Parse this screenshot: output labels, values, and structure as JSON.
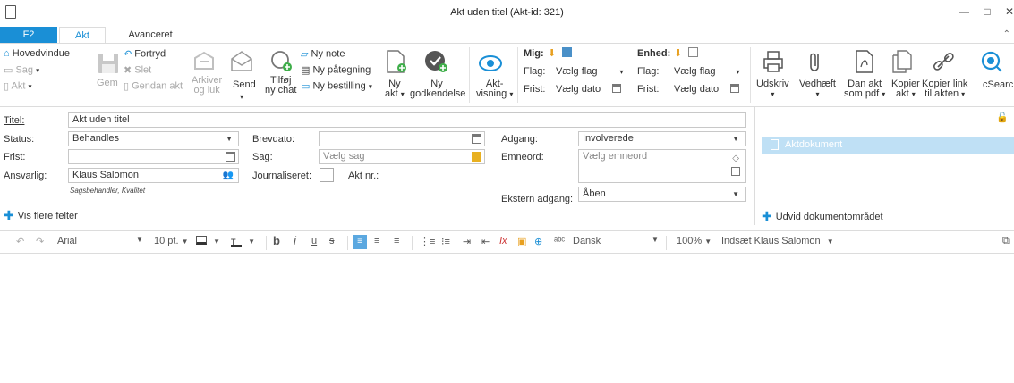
{
  "window": {
    "title": "Akt uden titel (Akt-id: 321)",
    "min": "—",
    "max": "□",
    "close": "✕"
  },
  "tabs": {
    "f2": "F2",
    "akt": "Akt",
    "avanceret": "Avanceret"
  },
  "ribbon": {
    "hovedvindue": "Hovedvindue",
    "sag": "Sag",
    "akt": "Akt",
    "gem": "Gem",
    "fortryd": "Fortryd",
    "slet": "Slet",
    "gendan_akt": "Gendan akt",
    "arkiver_line1": "Arkiver",
    "arkiver_line2": "og luk",
    "send": "Send",
    "tilfoej_line1": "Tilføj",
    "tilfoej_line2": "ny chat",
    "ny_note": "Ny note",
    "ny_paategning": "Ny påtegning",
    "ny_bestilling": "Ny bestilling",
    "ny_akt_line1": "Ny",
    "ny_akt_line2": "akt",
    "ny_godk_line1": "Ny",
    "ny_godk_line2": "godkendelse",
    "aktvisning_line1": "Akt-",
    "aktvisning_line2": "visning",
    "mig_label": "Mig:",
    "enhed_label": "Enhed:",
    "flag_label": "Flag:",
    "frist_label": "Frist:",
    "vaelg_flag": "Vælg flag",
    "vaelg_dato": "Vælg dato",
    "udskriv": "Udskriv",
    "vedhaeft": "Vedhæft",
    "dan_akt_line1": "Dan akt",
    "dan_akt_line2": "som pdf",
    "kopier_akt_line1": "Kopier",
    "kopier_akt_line2": "akt",
    "kopier_link_line1": "Kopier link",
    "kopier_link_line2": "til akten",
    "csearch": "cSearch"
  },
  "form": {
    "titel_label": "Titel:",
    "titel_value": "Akt uden titel",
    "status_label": "Status:",
    "status_value": "Behandles",
    "frist_label": "Frist:",
    "ansvarlig_label": "Ansvarlig:",
    "ansvarlig_value": "Klaus Salomon",
    "ansvarlig_note": "Sagsbehandler, Kvalitet",
    "brevdato_label": "Brevdato:",
    "sag_label": "Sag:",
    "sag_placeholder": "Vælg sag",
    "journaliseret_label": "Journaliseret:",
    "akt_nr_label": "Akt nr.:",
    "adgang_label": "Adgang:",
    "adgang_value": "Involverede",
    "emneord_label": "Emneord:",
    "emneord_placeholder": "Vælg emneord",
    "ekstern_label": "Ekstern adgang:",
    "ekstern_value": "Åben",
    "vis_flere": "Vis flere felter"
  },
  "panel": {
    "aktdokument": "Aktdokument",
    "udvid": "Udvid dokumentområdet"
  },
  "editor": {
    "font": "Arial",
    "size": "10 pt.",
    "language": "Dansk",
    "zoom": "100%",
    "indsaet": "Indsæt Klaus Salomon"
  }
}
